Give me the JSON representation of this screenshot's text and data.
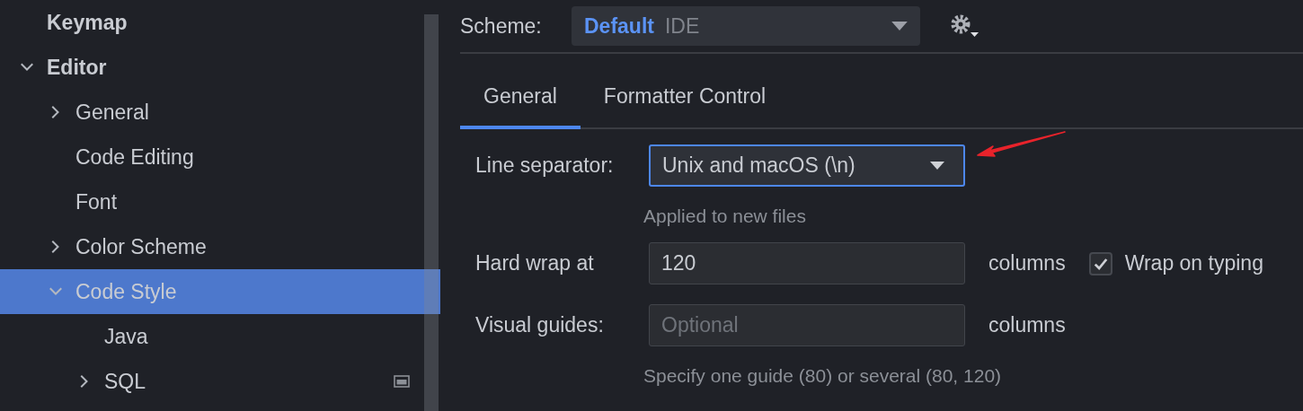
{
  "sidebar": {
    "items": [
      {
        "label": "Keymap",
        "kind": "leaf",
        "selected": false
      },
      {
        "label": "Editor",
        "kind": "folder",
        "expanded": true,
        "selected": false,
        "children": [
          {
            "label": "General",
            "kind": "folder",
            "expanded": false,
            "selected": false
          },
          {
            "label": "Code Editing",
            "kind": "leaf",
            "selected": false
          },
          {
            "label": "Font",
            "kind": "leaf",
            "selected": false
          },
          {
            "label": "Color Scheme",
            "kind": "folder",
            "expanded": false,
            "selected": false
          },
          {
            "label": "Code Style",
            "kind": "folder",
            "expanded": true,
            "selected": true,
            "children": [
              {
                "label": "Java",
                "kind": "leaf",
                "selected": false
              },
              {
                "label": "SQL",
                "kind": "folder",
                "expanded": false,
                "selected": false,
                "badge": true
              }
            ]
          }
        ]
      }
    ]
  },
  "scheme": {
    "label": "Scheme:",
    "value": "Default",
    "suffix": "IDE"
  },
  "tabs": [
    {
      "label": "General",
      "selected": true
    },
    {
      "label": "Formatter Control",
      "selected": false
    }
  ],
  "settings": [
    {
      "kind": "dropdown",
      "label": "Line separator:",
      "value": "Unix and macOS (\\n)",
      "focused": true,
      "hint": "Applied to new files"
    },
    {
      "kind": "text",
      "label": "Hard wrap at",
      "value": "120",
      "unit": "columns",
      "checkbox": {
        "label": "Wrap on typing",
        "checked": true
      }
    },
    {
      "kind": "text",
      "label": "Visual guides:",
      "placeholder": "Optional",
      "unit": "columns",
      "hint": "Specify one guide (80) or several (80, 120)"
    }
  ]
}
